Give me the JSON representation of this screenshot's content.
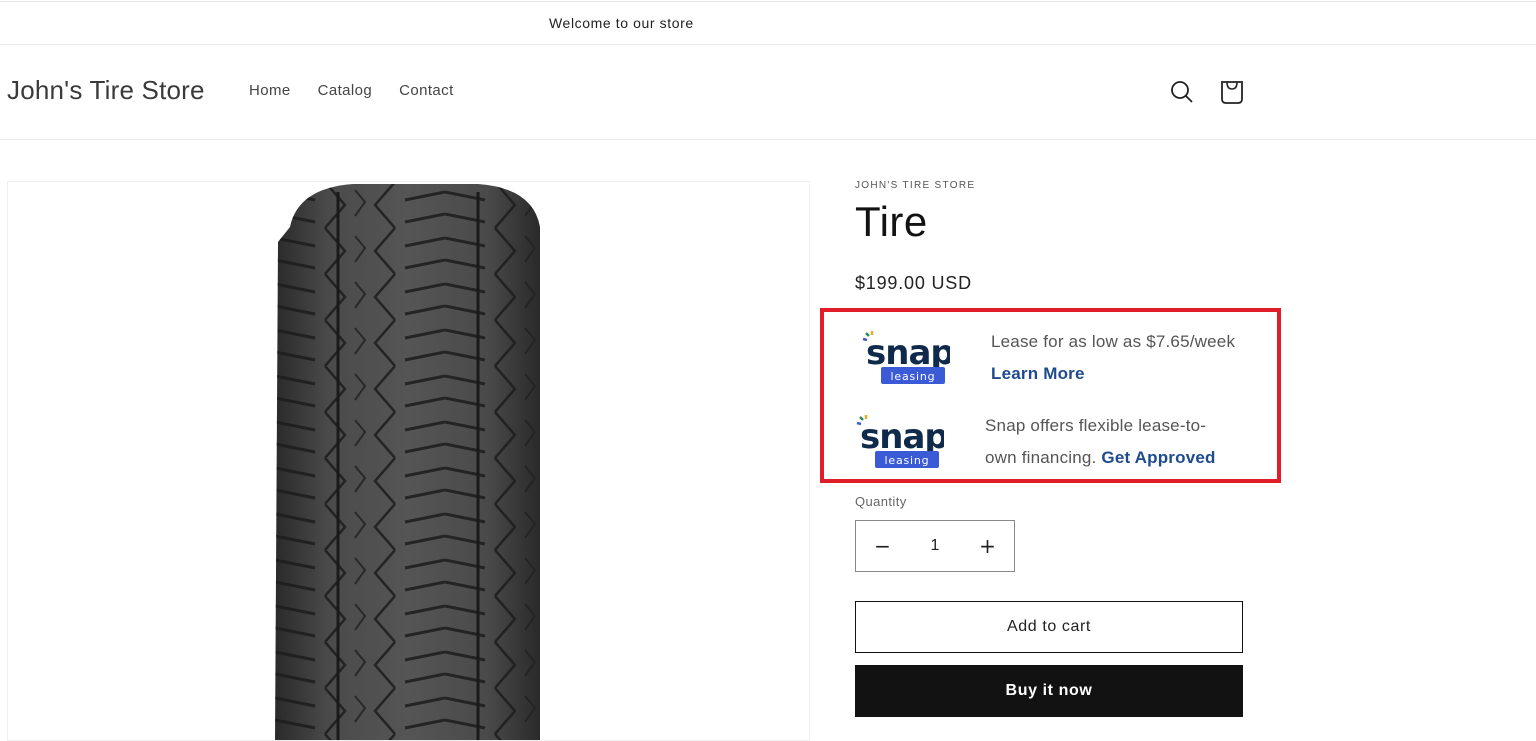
{
  "announcement": {
    "text": "Welcome to our store"
  },
  "header": {
    "store_name": "John's Tire Store",
    "nav": [
      {
        "label": "Home"
      },
      {
        "label": "Catalog"
      },
      {
        "label": "Contact"
      }
    ],
    "icons": {
      "search": "search-icon",
      "cart": "cart-icon"
    }
  },
  "product": {
    "vendor": "JOHN'S TIRE STORE",
    "title": "Tire",
    "price": "$199.00 USD",
    "image_alt": "Tire tread image",
    "snap": {
      "brand_word": "snap",
      "badge": "leasing",
      "colors": {
        "navy": "#0f2a4a",
        "badge": "#3b5bd6",
        "link": "#1f4b8e",
        "highlight_border": "#e01e2a"
      },
      "offer1": {
        "text": "Lease for as low as $7.65/week",
        "link": "Learn More"
      },
      "offer2": {
        "text_line1": "Snap offers flexible lease-to-",
        "text_line2": "own financing.",
        "link": "Get Approved"
      }
    },
    "quantity": {
      "label": "Quantity",
      "value": "1",
      "decrement": "−",
      "increment": "+"
    },
    "buttons": {
      "add_to_cart": "Add to cart",
      "buy_now": "Buy it now"
    }
  }
}
